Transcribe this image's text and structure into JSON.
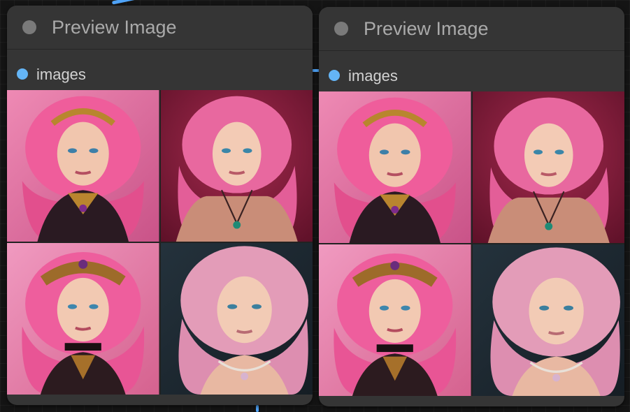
{
  "nodes": [
    {
      "title": "Preview Image",
      "input": {
        "label": "images",
        "color": "#64b5f6"
      },
      "images": [
        {
          "description": "pink-haired woman with golden tiara and ornate necklace",
          "bg": "#e57aa7"
        },
        {
          "description": "pink-haired woman with green pendant, dark red background",
          "bg": "#8f1f3f"
        },
        {
          "description": "pink-haired woman with jeweled crown and black lace choker",
          "bg": "#e884ac"
        },
        {
          "description": "pink-haired woman with pearl necklace, dark teal background",
          "bg": "#1f2c36"
        }
      ]
    },
    {
      "title": "Preview Image",
      "input": {
        "label": "images",
        "color": "#64b5f6"
      },
      "images": [
        {
          "description": "pink-haired woman with golden tiara and ornate necklace",
          "bg": "#e57aa7"
        },
        {
          "description": "pink-haired woman with green pendant, dark red background",
          "bg": "#8f1f3f"
        },
        {
          "description": "pink-haired woman with jeweled crown and black lace choker",
          "bg": "#e884ac"
        },
        {
          "description": "pink-haired woman with pearl necklace, dark teal background",
          "bg": "#1f2c36"
        }
      ]
    }
  ],
  "colors": {
    "canvas": "#141414",
    "node_body": "#353535",
    "title_text": "#aaaaaa",
    "wire": "#4fa3f7"
  }
}
